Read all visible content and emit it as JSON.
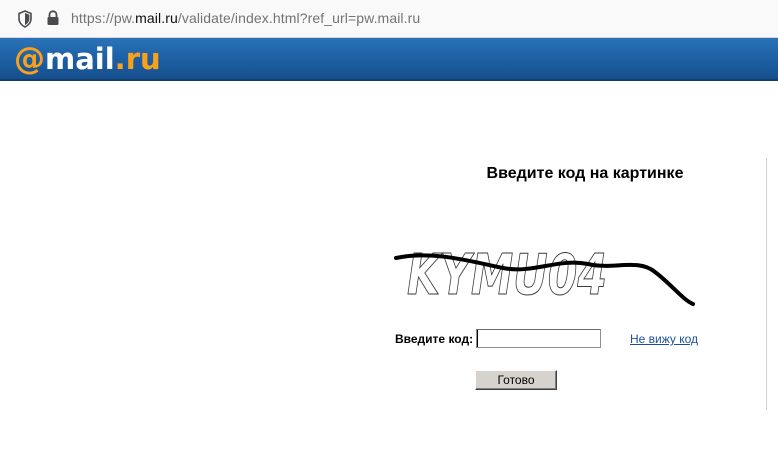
{
  "browser": {
    "url_prefix": "https://pw.",
    "url_domain": "mail.ru",
    "url_suffix": "/validate/index.html?ref_url=pw.mail.ru"
  },
  "logo": {
    "at": "@",
    "word": "mail",
    "dot": ".",
    "ru": "ru",
    "brand_orange": "#f9a11b",
    "brand_blue": "#1d5ea2"
  },
  "captcha_page": {
    "title": "Введите код на картинке",
    "captcha_text": "KYMU04",
    "code_label": "Введите код:",
    "code_value": "",
    "cant_see_link": "Не вижу код",
    "submit_label": "Готово"
  }
}
